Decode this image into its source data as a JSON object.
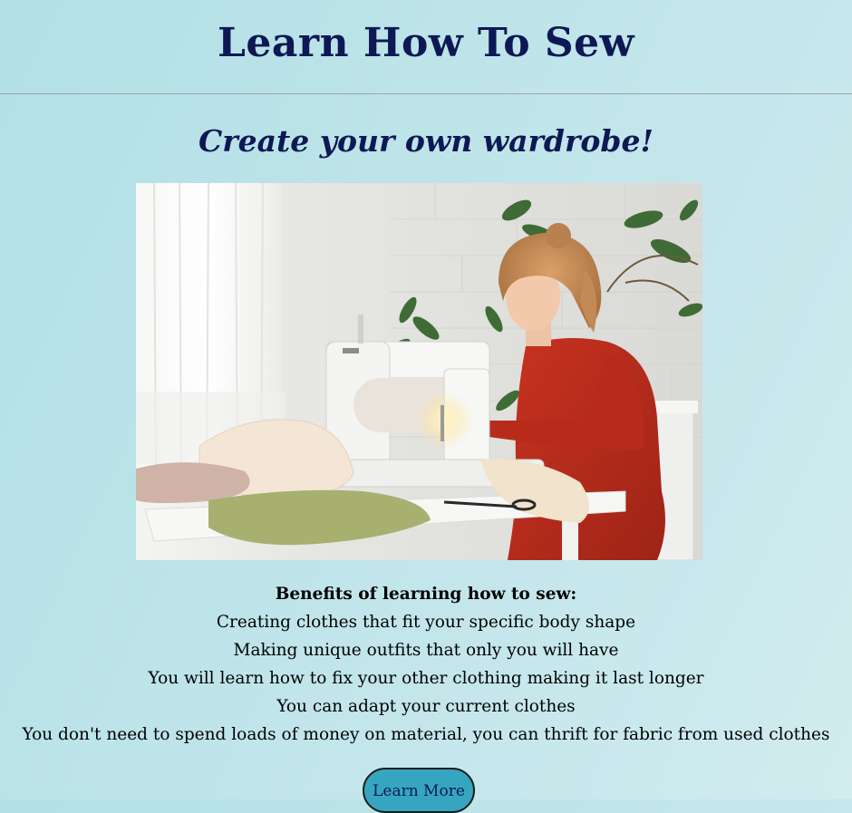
{
  "header": {
    "title": "Learn How To Sew"
  },
  "main": {
    "subtitle": "Create your own wardrobe!",
    "hero_image": {
      "alt": "Woman sewing at a sewing machine"
    },
    "benefits": {
      "heading": "Benefits of learning how to sew:",
      "items": [
        "Creating clothes that fit your specific body shape",
        "Making unique outfits that only you will have",
        "You will learn how to fix your other clothing making it last longer",
        "You can adapt your current clothes",
        "You don't need to spend loads of money on material, you can thrift for fabric from used clothes"
      ]
    },
    "cta_button": {
      "label": "Learn More"
    }
  },
  "colors": {
    "background": "#bde4e9",
    "heading_text": "#0d1854",
    "button_fill": "#36a6c0"
  }
}
